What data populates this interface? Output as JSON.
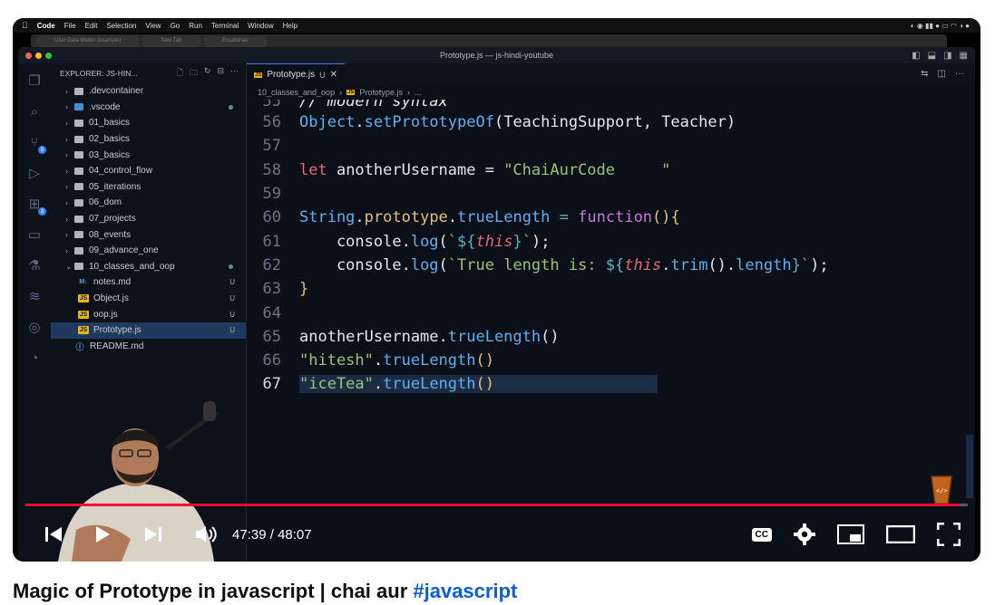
{
  "mac_menubar": {
    "app": "Code",
    "items": [
      "File",
      "Edit",
      "Selection",
      "View",
      "Go",
      "Run",
      "Terminal",
      "Window",
      "Help"
    ]
  },
  "browser_tabs": [
    "User Data Model (example)",
    "New Tab",
    "Excalidraw"
  ],
  "window": {
    "title": "Prototype.js — js-hindi-youtube"
  },
  "explorer": {
    "header": "EXPLORER: JS-HIN...",
    "items": [
      {
        "label": ".devcontainer",
        "kind": "folder",
        "status": ""
      },
      {
        "label": ".vscode",
        "kind": "folder-blue",
        "status": "dot"
      },
      {
        "label": "01_basics",
        "kind": "folder",
        "status": ""
      },
      {
        "label": "02_basics",
        "kind": "folder",
        "status": ""
      },
      {
        "label": "03_basics",
        "kind": "folder",
        "status": ""
      },
      {
        "label": "04_control_flow",
        "kind": "folder",
        "status": ""
      },
      {
        "label": "05_iterations",
        "kind": "folder",
        "status": ""
      },
      {
        "label": "06_dom",
        "kind": "folder",
        "status": ""
      },
      {
        "label": "07_projects",
        "kind": "folder",
        "status": ""
      },
      {
        "label": "08_events",
        "kind": "folder",
        "status": ""
      },
      {
        "label": "09_advance_one",
        "kind": "folder",
        "status": ""
      },
      {
        "label": "10_classes_and_oop",
        "kind": "folder-open",
        "status": "dot"
      },
      {
        "label": "notes.md",
        "kind": "md",
        "status": "U"
      },
      {
        "label": "Object.js",
        "kind": "js",
        "status": "U"
      },
      {
        "label": "oop.js",
        "kind": "js",
        "status": "U"
      },
      {
        "label": "Prototype.js",
        "kind": "js",
        "status": "U"
      },
      {
        "label": "README.md",
        "kind": "info",
        "status": ""
      }
    ]
  },
  "editor": {
    "tab": {
      "label": "Prototype.js",
      "status": "U"
    },
    "breadcrumb": [
      "10_classes_and_oop",
      "Prototype.js",
      "..."
    ],
    "current_line": "67"
  },
  "player": {
    "time_current": "47:39",
    "time_separator": "/",
    "time_total": "48:07",
    "progress": 0.99,
    "cc_label": "CC"
  },
  "video_title": {
    "text": "Magic of Prototype in javascript | chai aur ",
    "hashtag": "#javascript"
  }
}
